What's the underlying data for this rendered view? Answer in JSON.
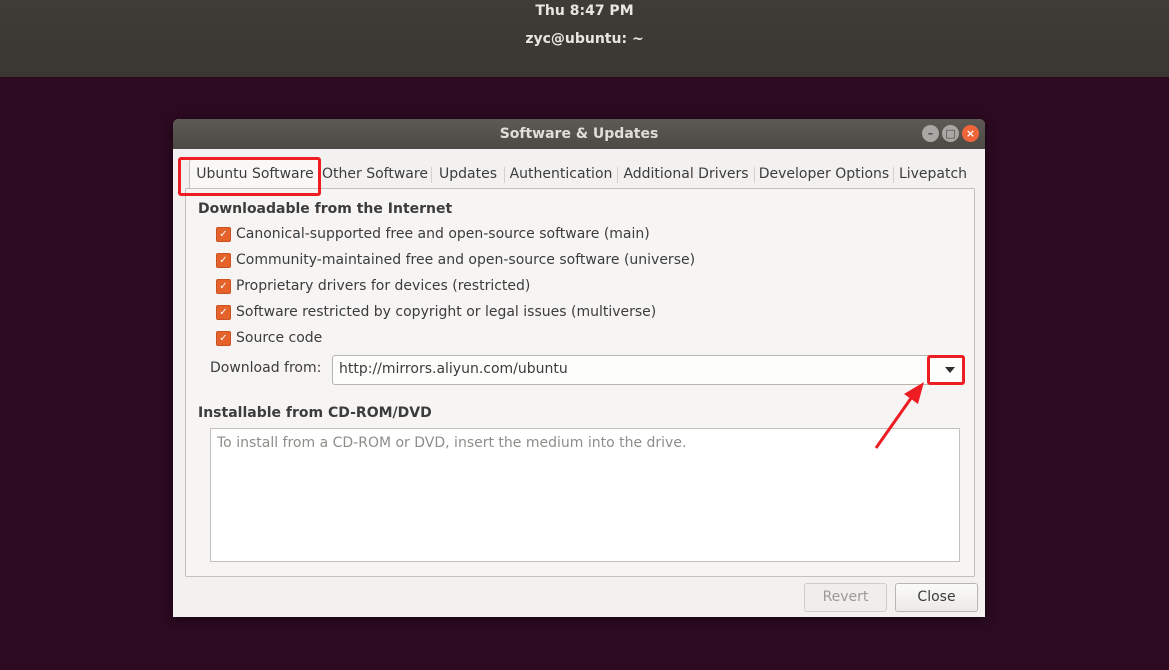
{
  "topbar": {
    "clock": "Thu  8:47 PM",
    "terminal_title": "zyc@ubuntu: ~"
  },
  "window": {
    "title": "Software & Updates",
    "buttons": {
      "minimize": "–",
      "maximize": "□",
      "close": "×"
    }
  },
  "tabs": [
    {
      "label": "Ubuntu Software",
      "active": true
    },
    {
      "label": "Other Software"
    },
    {
      "label": "Updates"
    },
    {
      "label": "Authentication"
    },
    {
      "label": "Additional Drivers"
    },
    {
      "label": "Developer Options"
    },
    {
      "label": "Livepatch"
    }
  ],
  "internet": {
    "title": "Downloadable from the Internet",
    "items": [
      {
        "label": "Canonical-supported free and open-source software (main)",
        "checked": true
      },
      {
        "label": "Community-maintained free and open-source software (universe)",
        "checked": true
      },
      {
        "label": "Proprietary drivers for devices (restricted)",
        "checked": true
      },
      {
        "label": "Software restricted by copyright or legal issues (multiverse)",
        "checked": true
      },
      {
        "label": "Source code",
        "checked": true
      }
    ],
    "download_from_label": "Download from:",
    "download_from_value": "http://mirrors.aliyun.com/ubuntu"
  },
  "cdrom": {
    "title": "Installable from CD-ROM/DVD",
    "placeholder": "To install from a CD-ROM or DVD, insert the medium into the drive."
  },
  "footer": {
    "revert_label": "Revert",
    "close_label": "Close"
  },
  "colors": {
    "checkbox": "#e5622a",
    "annotation": "#ee1d24",
    "desktop": "#2c0a21"
  }
}
